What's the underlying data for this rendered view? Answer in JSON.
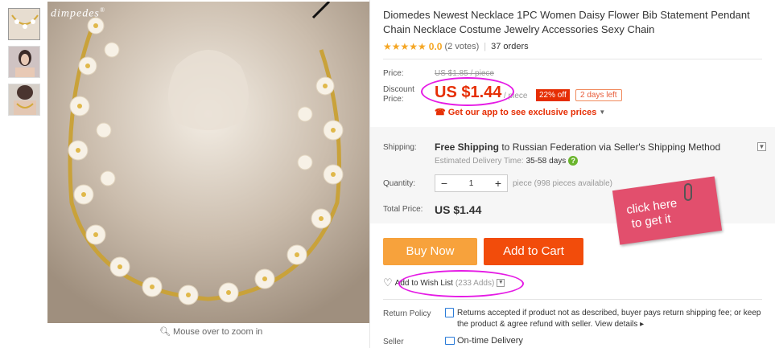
{
  "brand": {
    "name": "dimpedes",
    "mark": "®"
  },
  "product": {
    "title": "Diomedes Newest Necklace 1PC Women Daisy Flower Bib Statement Pendant Chain Necklace Costume Jewelry Accessories Sexy Chain",
    "rating_value": "0.0",
    "votes": "(2 votes)",
    "orders": "37 orders"
  },
  "price": {
    "price_label": "Price:",
    "original": "US $1.85 / piece",
    "discount_label_1": "Discount",
    "discount_label_2": "Price:",
    "discounted": "US $1.44",
    "per_unit": "/ piece",
    "off_badge": "22% off",
    "time_left": "2 days left",
    "app_promo": "Get our app to see exclusive prices"
  },
  "shipping": {
    "label": "Shipping:",
    "method_prefix": "Free Shipping",
    "method_text": " to Russian Federation via Seller's Shipping Method",
    "est_label": "Estimated Delivery Time:",
    "est_value": "35-58",
    "est_unit": "days"
  },
  "quantity": {
    "label": "Quantity:",
    "value": "1",
    "availability": "piece (998 pieces available)"
  },
  "total": {
    "label": "Total Price:",
    "value": "US $1.44"
  },
  "sticker": {
    "line1": "click here",
    "line2": "to get it"
  },
  "actions": {
    "buy_now": "Buy Now",
    "add_to_cart": "Add to Cart"
  },
  "wishlist": {
    "label": "Add to Wish List",
    "count": "(233 Adds)"
  },
  "policy": {
    "return_label": "Return Policy",
    "return_text": "Returns accepted if product not as described, buyer pays return shipping fee; or keep the product & agree refund with seller.",
    "view_details": "View details",
    "seller_label": "Seller",
    "seller_guarantee": "On-time Delivery"
  },
  "image": {
    "zoom_hint": "Mouse over to zoom in"
  },
  "colors": {
    "accent": "#e62e04",
    "buy": "#f7a23c",
    "cart": "#f24c0b",
    "highlight": "#e51be5"
  },
  "icons": [
    "star-icon",
    "dropdown-chevron-icon",
    "question-icon",
    "heart-icon",
    "magnifier-icon",
    "return-policy-icon",
    "delivery-icon",
    "paperclip-icon"
  ]
}
